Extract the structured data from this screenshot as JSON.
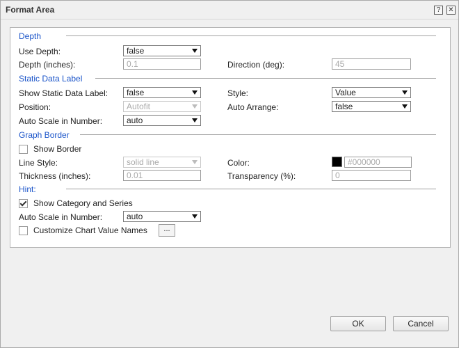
{
  "window": {
    "title": "Format Area",
    "help_glyph": "?",
    "close_glyph": "✕"
  },
  "depth": {
    "section_title": "Depth",
    "use_depth_label": "Use Depth:",
    "use_depth_value": "false",
    "depth_label": "Depth (inches):",
    "depth_value": "0.1",
    "direction_label": "Direction (deg):",
    "direction_value": "45"
  },
  "static_label": {
    "section_title": "Static Data Label",
    "show_label": "Show Static Data Label:",
    "show_value": "false",
    "style_label": "Style:",
    "style_value": "Value",
    "position_label": "Position:",
    "position_value": "Autofit",
    "auto_arrange_label": "Auto Arrange:",
    "auto_arrange_value": "false",
    "auto_scale_label": "Auto Scale in Number:",
    "auto_scale_value": "auto"
  },
  "graph_border": {
    "section_title": "Graph Border",
    "show_border_label": "Show Border",
    "show_border_checked": false,
    "line_style_label": "Line Style:",
    "line_style_value": "solid line",
    "color_label": "Color:",
    "color_value": "#000000",
    "thickness_label": "Thickness (inches):",
    "thickness_value": "0.01",
    "transparency_label": "Transparency (%):",
    "transparency_value": "0"
  },
  "hint": {
    "section_title": "Hint:",
    "show_cat_label": "Show Category and Series",
    "show_cat_checked": true,
    "auto_scale_label": "Auto Scale in Number:",
    "auto_scale_value": "auto",
    "customize_label": "Customize Chart Value Names",
    "customize_checked": false,
    "browse_label": "..."
  },
  "footer": {
    "ok_label": "OK",
    "cancel_label": "Cancel"
  }
}
